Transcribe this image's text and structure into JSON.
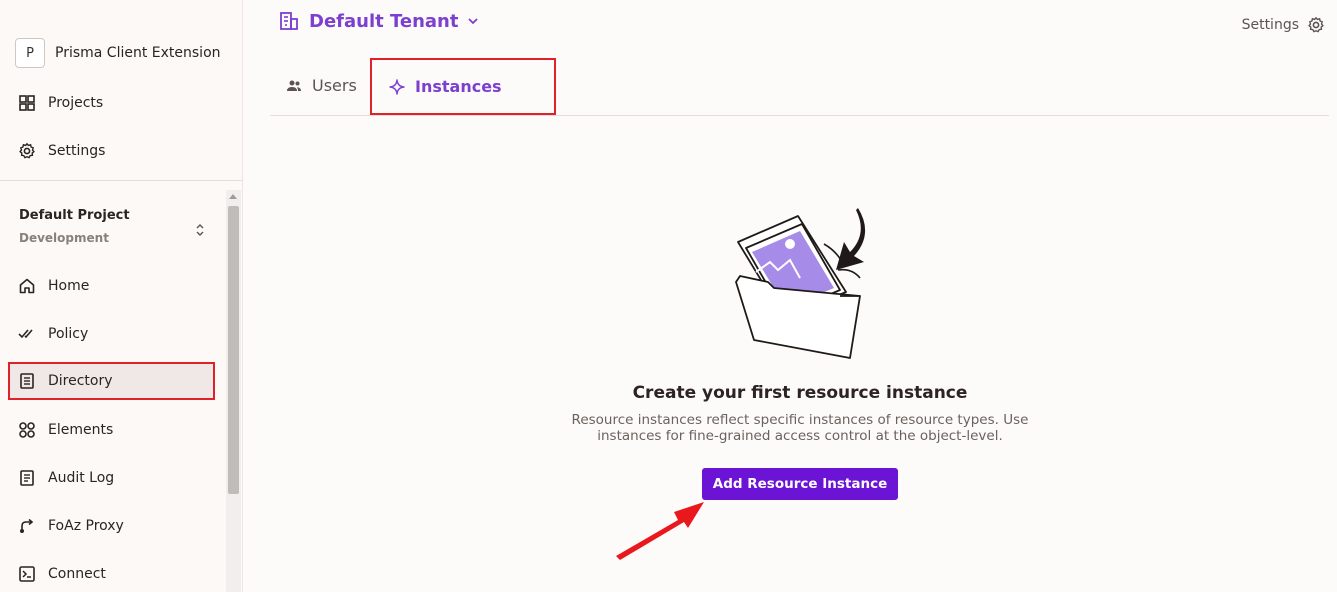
{
  "organization": {
    "initial": "P",
    "name": "Prisma Client Extension"
  },
  "nav_top": [
    {
      "label": "Projects",
      "icon": "grid-icon"
    },
    {
      "label": "Settings",
      "icon": "gear-icon"
    }
  ],
  "project": {
    "name": "Default Project",
    "environment": "Development"
  },
  "nav_main": [
    {
      "label": "Home",
      "icon": "home-icon"
    },
    {
      "label": "Policy",
      "icon": "double-check-icon"
    },
    {
      "label": "Directory",
      "icon": "directory-icon",
      "active": true
    },
    {
      "label": "Elements",
      "icon": "elements-icon"
    },
    {
      "label": "Audit Log",
      "icon": "audit-log-icon"
    },
    {
      "label": "FoAz Proxy",
      "icon": "proxy-icon"
    },
    {
      "label": "Connect",
      "icon": "terminal-icon"
    }
  ],
  "header": {
    "tenant": "Default Tenant",
    "settings_label": "Settings"
  },
  "tabs": [
    {
      "label": "Users",
      "icon": "users-icon"
    },
    {
      "label": "Instances",
      "icon": "sparkle-icon",
      "active": true
    }
  ],
  "empty_state": {
    "title": "Create your first resource instance",
    "description": "Resource instances reflect specific instances of resource types. Use instances for fine-grained access control at the object-level.",
    "button_label": "Add Resource Instance"
  },
  "colors": {
    "accent": "#7c3fd0",
    "button": "#6b14d6",
    "highlight": "#e0202a"
  }
}
